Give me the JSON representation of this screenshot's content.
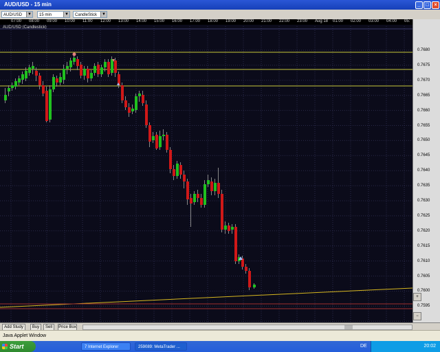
{
  "window": {
    "title": "AUD/USD - 15 min"
  },
  "toolbar": {
    "symbol": "AUD/USD",
    "period": "15 min",
    "chart_type": "CandleStick"
  },
  "chart": {
    "label": "AUD/USD (Candlestick)",
    "time_labels": [
      "07:00",
      "08:00",
      "09:00",
      "10:00",
      "11:00",
      "12:00",
      "13:00",
      "14:00",
      "15:00",
      "16:00",
      "17:00",
      "18:00",
      "19:00",
      "20:00",
      "21:00",
      "22:00",
      "23:00",
      "Aug 18",
      "01:00",
      "02:00",
      "03:00",
      "04:00",
      "05:"
    ],
    "price_labels": [
      "0.7680",
      "0.7675",
      "0.7670",
      "0.7665",
      "0.7660",
      "0.7655",
      "0.7650",
      "0.7645",
      "0.7640",
      "0.7635",
      "0.7630",
      "0.7625",
      "0.7620",
      "0.7615",
      "0.7610",
      "0.7605",
      "0.7600",
      "0.7595"
    ],
    "colors": {
      "bull": "#20c020",
      "bear": "#d01818",
      "level": "#c8c83a",
      "trend": "#d8b820",
      "red_line": "#a03030"
    }
  },
  "bottom": {
    "add_study": "Add Study",
    "buy": "Buy",
    "sell": "Sell",
    "price_box": "Price Box"
  },
  "status": {
    "text": "Java Applet Window"
  },
  "taskbar": {
    "start": "Start",
    "ie": "7 Internet Explorer",
    "mt": "259089: MetaTrader ...",
    "lang": "DE",
    "clock": "20:02"
  }
}
